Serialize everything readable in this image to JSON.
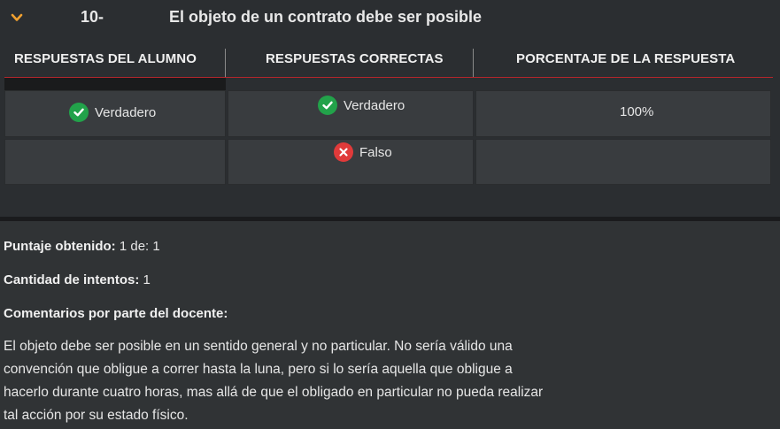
{
  "question": {
    "number": "10-",
    "title": "El objeto de un contrato debe ser posible"
  },
  "table": {
    "headers": [
      "RESPUESTAS DEL ALUMNO",
      "RESPUESTAS CORRECTAS",
      "PORCENTAJE DE LA RESPUESTA"
    ],
    "rows": [
      {
        "alumno": "Verdadero",
        "correcta": "Verdadero",
        "porcentaje": "100%"
      },
      {
        "alumno": "",
        "correcta": "Falso",
        "porcentaje": ""
      }
    ]
  },
  "summary": {
    "puntaje_label": "Puntaje obtenido:",
    "puntaje_value": "1 de: 1",
    "intentos_label": "Cantidad de intentos:",
    "intentos_value": "1",
    "comentarios_label": "Comentarios por parte del docente:",
    "comentario": "El objeto debe ser posible en un sentido general y no particular. No sería válido una convención que obligue a correr hasta la luna, pero si lo sería aquella que obligue a hacerlo durante cuatro horas, mas allá de que el obligado en particular no pueda realizar tal acción por su estado físico."
  },
  "colors": {
    "chevron": "#f0a030",
    "check": "#22a24a",
    "cross": "#e03a3a",
    "header_underline": "#b3262c"
  },
  "icons": [
    "chevron-down-icon",
    "check-circle-icon",
    "x-circle-icon"
  ]
}
